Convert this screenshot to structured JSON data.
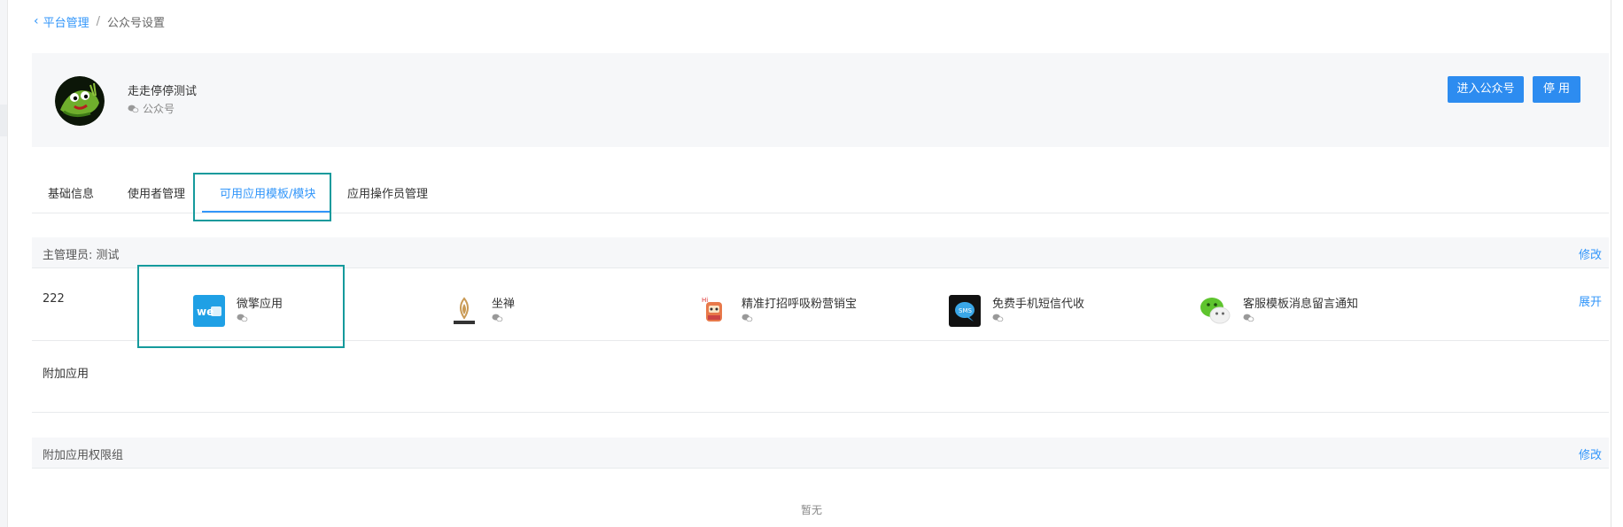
{
  "breadcrumb": {
    "back_label": "平台管理",
    "separator": "/",
    "current": "公众号设置"
  },
  "account": {
    "name": "走走停停测试",
    "type_label": "公众号",
    "enter_button": "进入公众号",
    "stop_button": "停 用"
  },
  "tabs": [
    {
      "label": "基础信息"
    },
    {
      "label": "使用者管理"
    },
    {
      "label": "可用应用模板/模块",
      "active": true
    },
    {
      "label": "应用操作员管理"
    }
  ],
  "admin_section": {
    "title": "主管理员: 测试",
    "edit_label": "修改"
  },
  "apps_row": {
    "label": "222",
    "expand_label": "展开",
    "apps": [
      {
        "name": "微擎应用",
        "icon": "weiqing-app-icon"
      },
      {
        "name": "坐禅",
        "icon": "zuochan-icon"
      },
      {
        "name": "精准打招呼吸粉营销宝",
        "icon": "greeting-robot-icon"
      },
      {
        "name": "免费手机短信代收",
        "icon": "sms-bubble-icon"
      },
      {
        "name": "客服模板消息留言通知",
        "icon": "wechat-icon"
      }
    ]
  },
  "extra_row": {
    "label": "附加应用"
  },
  "perm_section": {
    "title": "附加应用权限组",
    "edit_label": "修改"
  },
  "empty_text": "暂无",
  "colors": {
    "accent": "#3296fa",
    "button": "#2d8cf0",
    "highlight": "#159a9c",
    "card_bg": "#f6f7f9"
  }
}
